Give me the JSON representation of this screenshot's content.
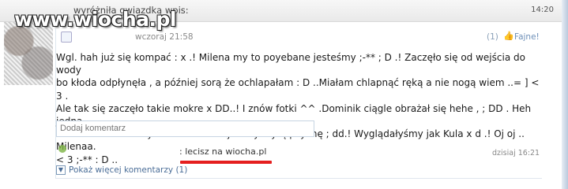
{
  "header": {
    "action": "wyróżniła gwiazdką wpis:",
    "time": "14:20"
  },
  "watermark": "www.wiocha.pl",
  "post": {
    "time": "wczoraj 21:58",
    "likes_count": "(1)",
    "like_label": "Fajne!",
    "text": "Wgl. hah już się kompać : x .! Milena my to poyebane jesteśmy ;-** ; D .! Zaczęło się od wejścia do wody\nbo kłoda odpłynęła , a później sorą że ochlapałam : D ..Miałam chlapnąć ręką a nie nogą wiem ..= ] < 3 .\nAle tak się zaczęło takie mokre x DD..! I znów fotki ^^ .Dominik ciągle obrażał się hehe , ; DD . Heh jedna\nbluza na dwie osoby to trzeba mieć jak my zrytą psychę ; dd.! Wyglądałyśmy jak Kula x d .! Oj oj .. Milenaa.\n< 3 ;-** : D .."
  },
  "comment_box": {
    "placeholder": "Dodaj komentarz"
  },
  "comment": {
    "text": ": lecisz na wiocha.pl",
    "time": "dzisiaj 16:21"
  },
  "show_more": {
    "label": "Pokaż więcej komentarzy",
    "count": "(1)"
  },
  "colors": {
    "underline": "#e51f1f",
    "link": "#4b6e98"
  }
}
